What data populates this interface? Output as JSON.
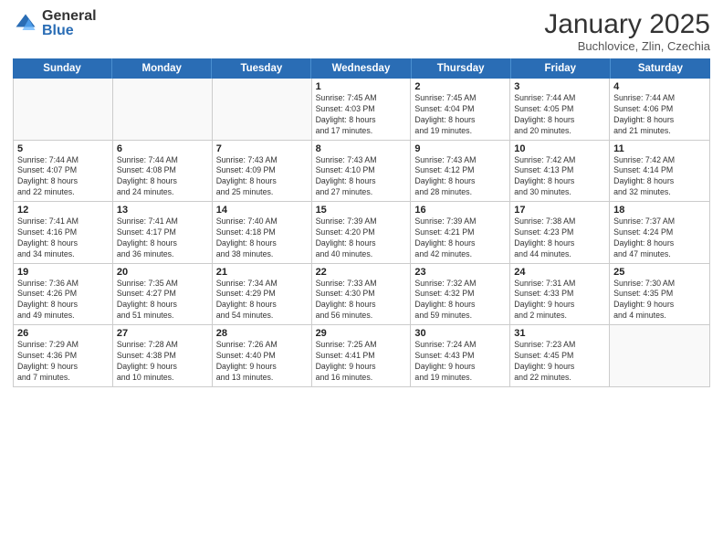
{
  "logo": {
    "general": "General",
    "blue": "Blue"
  },
  "header": {
    "month": "January 2025",
    "location": "Buchlovice, Zlin, Czechia"
  },
  "weekdays": [
    "Sunday",
    "Monday",
    "Tuesday",
    "Wednesday",
    "Thursday",
    "Friday",
    "Saturday"
  ],
  "rows": [
    [
      {
        "day": "",
        "info": ""
      },
      {
        "day": "",
        "info": ""
      },
      {
        "day": "",
        "info": ""
      },
      {
        "day": "1",
        "info": "Sunrise: 7:45 AM\nSunset: 4:03 PM\nDaylight: 8 hours\nand 17 minutes."
      },
      {
        "day": "2",
        "info": "Sunrise: 7:45 AM\nSunset: 4:04 PM\nDaylight: 8 hours\nand 19 minutes."
      },
      {
        "day": "3",
        "info": "Sunrise: 7:44 AM\nSunset: 4:05 PM\nDaylight: 8 hours\nand 20 minutes."
      },
      {
        "day": "4",
        "info": "Sunrise: 7:44 AM\nSunset: 4:06 PM\nDaylight: 8 hours\nand 21 minutes."
      }
    ],
    [
      {
        "day": "5",
        "info": "Sunrise: 7:44 AM\nSunset: 4:07 PM\nDaylight: 8 hours\nand 22 minutes."
      },
      {
        "day": "6",
        "info": "Sunrise: 7:44 AM\nSunset: 4:08 PM\nDaylight: 8 hours\nand 24 minutes."
      },
      {
        "day": "7",
        "info": "Sunrise: 7:43 AM\nSunset: 4:09 PM\nDaylight: 8 hours\nand 25 minutes."
      },
      {
        "day": "8",
        "info": "Sunrise: 7:43 AM\nSunset: 4:10 PM\nDaylight: 8 hours\nand 27 minutes."
      },
      {
        "day": "9",
        "info": "Sunrise: 7:43 AM\nSunset: 4:12 PM\nDaylight: 8 hours\nand 28 minutes."
      },
      {
        "day": "10",
        "info": "Sunrise: 7:42 AM\nSunset: 4:13 PM\nDaylight: 8 hours\nand 30 minutes."
      },
      {
        "day": "11",
        "info": "Sunrise: 7:42 AM\nSunset: 4:14 PM\nDaylight: 8 hours\nand 32 minutes."
      }
    ],
    [
      {
        "day": "12",
        "info": "Sunrise: 7:41 AM\nSunset: 4:16 PM\nDaylight: 8 hours\nand 34 minutes."
      },
      {
        "day": "13",
        "info": "Sunrise: 7:41 AM\nSunset: 4:17 PM\nDaylight: 8 hours\nand 36 minutes."
      },
      {
        "day": "14",
        "info": "Sunrise: 7:40 AM\nSunset: 4:18 PM\nDaylight: 8 hours\nand 38 minutes."
      },
      {
        "day": "15",
        "info": "Sunrise: 7:39 AM\nSunset: 4:20 PM\nDaylight: 8 hours\nand 40 minutes."
      },
      {
        "day": "16",
        "info": "Sunrise: 7:39 AM\nSunset: 4:21 PM\nDaylight: 8 hours\nand 42 minutes."
      },
      {
        "day": "17",
        "info": "Sunrise: 7:38 AM\nSunset: 4:23 PM\nDaylight: 8 hours\nand 44 minutes."
      },
      {
        "day": "18",
        "info": "Sunrise: 7:37 AM\nSunset: 4:24 PM\nDaylight: 8 hours\nand 47 minutes."
      }
    ],
    [
      {
        "day": "19",
        "info": "Sunrise: 7:36 AM\nSunset: 4:26 PM\nDaylight: 8 hours\nand 49 minutes."
      },
      {
        "day": "20",
        "info": "Sunrise: 7:35 AM\nSunset: 4:27 PM\nDaylight: 8 hours\nand 51 minutes."
      },
      {
        "day": "21",
        "info": "Sunrise: 7:34 AM\nSunset: 4:29 PM\nDaylight: 8 hours\nand 54 minutes."
      },
      {
        "day": "22",
        "info": "Sunrise: 7:33 AM\nSunset: 4:30 PM\nDaylight: 8 hours\nand 56 minutes."
      },
      {
        "day": "23",
        "info": "Sunrise: 7:32 AM\nSunset: 4:32 PM\nDaylight: 8 hours\nand 59 minutes."
      },
      {
        "day": "24",
        "info": "Sunrise: 7:31 AM\nSunset: 4:33 PM\nDaylight: 9 hours\nand 2 minutes."
      },
      {
        "day": "25",
        "info": "Sunrise: 7:30 AM\nSunset: 4:35 PM\nDaylight: 9 hours\nand 4 minutes."
      }
    ],
    [
      {
        "day": "26",
        "info": "Sunrise: 7:29 AM\nSunset: 4:36 PM\nDaylight: 9 hours\nand 7 minutes."
      },
      {
        "day": "27",
        "info": "Sunrise: 7:28 AM\nSunset: 4:38 PM\nDaylight: 9 hours\nand 10 minutes."
      },
      {
        "day": "28",
        "info": "Sunrise: 7:26 AM\nSunset: 4:40 PM\nDaylight: 9 hours\nand 13 minutes."
      },
      {
        "day": "29",
        "info": "Sunrise: 7:25 AM\nSunset: 4:41 PM\nDaylight: 9 hours\nand 16 minutes."
      },
      {
        "day": "30",
        "info": "Sunrise: 7:24 AM\nSunset: 4:43 PM\nDaylight: 9 hours\nand 19 minutes."
      },
      {
        "day": "31",
        "info": "Sunrise: 7:23 AM\nSunset: 4:45 PM\nDaylight: 9 hours\nand 22 minutes."
      },
      {
        "day": "",
        "info": ""
      }
    ]
  ]
}
